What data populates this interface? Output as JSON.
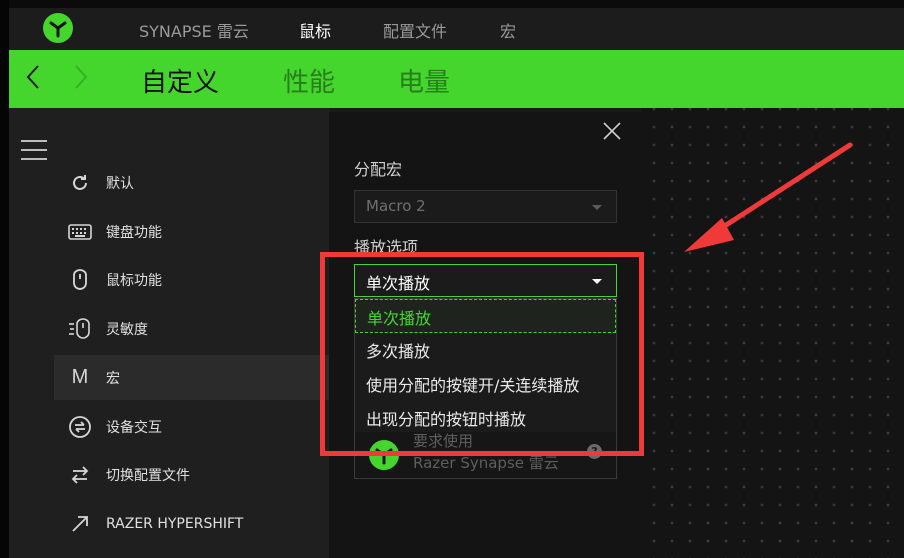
{
  "top_tabs": [
    "SYNAPSE 雷云",
    "鼠标",
    "配置文件",
    "宏"
  ],
  "green_tabs": [
    "自定义",
    "性能",
    "电量"
  ],
  "sidebar": {
    "items": [
      {
        "label": "默认",
        "icon": "refresh-icon"
      },
      {
        "label": "键盘功能",
        "icon": "keyboard-icon"
      },
      {
        "label": "鼠标功能",
        "icon": "mouse-icon"
      },
      {
        "label": "灵敏度",
        "icon": "sensitivity-icon"
      },
      {
        "label": "宏",
        "icon": "macro-m-icon"
      },
      {
        "label": "设备交互",
        "icon": "device-interaction-icon"
      },
      {
        "label": "切换配置文件",
        "icon": "switch-profile-icon"
      },
      {
        "label": "RAZER HYPERSHIFT",
        "icon": "hypershift-arrow-icon"
      }
    ]
  },
  "panel": {
    "assign_macro_label": "分配宏",
    "macro_select_value": "Macro 2",
    "playback_label": "播放选项",
    "playback_selected": "单次播放",
    "playback_options": [
      "单次播放",
      "多次播放",
      "使用分配的按键开/关连续播放",
      "出现分配的按钮时播放"
    ],
    "require_text_1": "要求使用",
    "require_text_2": "Razer Synapse 雷云"
  },
  "colors": {
    "accent": "#44d62c",
    "annotation": "#f03a3a"
  }
}
